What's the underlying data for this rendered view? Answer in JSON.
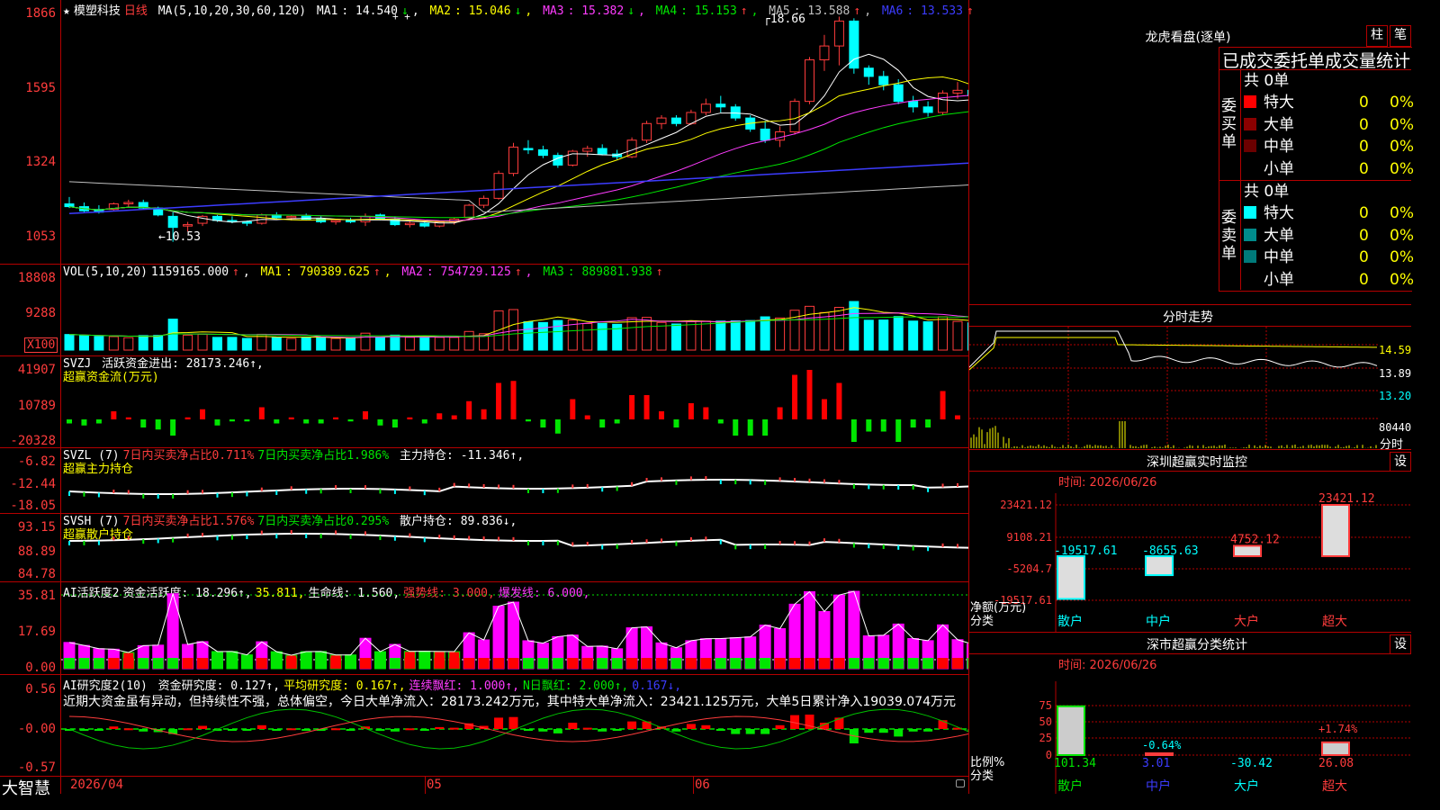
{
  "stock": {
    "star": "★",
    "name": "模塑科技",
    "period": "日线"
  },
  "ma_header": {
    "label": "MA(5,10,20,30,60,120)",
    "items": [
      {
        "name": "MA1",
        "value": "14.540",
        "arrow": "↓"
      },
      {
        "name": "MA2",
        "value": "15.046",
        "arrow": "↓"
      },
      {
        "name": "MA3",
        "value": "15.382",
        "arrow": "↓"
      },
      {
        "name": "MA4",
        "value": "15.153",
        "arrow": "↑"
      },
      {
        "name": "MA5",
        "value": "13.588",
        "arrow": "↑"
      },
      {
        "name": "MA6",
        "value": "13.533",
        "arrow": "↑"
      }
    ],
    "marks": "+ +"
  },
  "price_axis": [
    "1866",
    "1595",
    "1324",
    "1053"
  ],
  "price_annotations": {
    "high": "18.66",
    "low": "←10.53"
  },
  "vol_header": {
    "label": "VOL(5,10,20)",
    "value": "1159165.000",
    "arrow": "↑",
    "items": [
      {
        "name": "MA1",
        "value": "790389.625",
        "arrow": "↑"
      },
      {
        "name": "MA2",
        "value": "754729.125",
        "arrow": "↑"
      },
      {
        "name": "MA3",
        "value": "889881.938",
        "arrow": "↑"
      }
    ]
  },
  "vol_axis": [
    "18808",
    "9288",
    "X100"
  ],
  "svzj": {
    "label": "SVZJ",
    "title": "活跃资金进出: 28173.246↑,",
    "sub": "超赢资金流(万元)",
    "axis": [
      "41907",
      "10789",
      "-20328"
    ]
  },
  "svzl": {
    "label": "SVZL (7)",
    "p1": "7日内买卖净占比0.711%",
    "p2": "7日内买卖净占比1.986%",
    "p3": "主力持仓: -11.346↑,",
    "sub": "超赢主力持仓",
    "axis": [
      "-6.82",
      "-12.44",
      "-18.05"
    ]
  },
  "svsh": {
    "label": "SVSH (7)",
    "p1": "7日内买卖净占比1.576%",
    "p2": "7日内买卖净占比0.295%",
    "p3": "散户持仓: 89.836↓,",
    "sub": "超赢散户持仓",
    "axis": [
      "93.15",
      "88.89",
      "84.78"
    ]
  },
  "ai1": {
    "label": "AI活跃度2",
    "p1": "资金活跃度: 18.296↑,",
    "p2": "35.811,",
    "p3": "生命线: 1.560,",
    "p4": "强势线: 3.000,",
    "p5": "爆发线: 6.000,",
    "axis": [
      "35.81",
      "17.69",
      "0.00"
    ]
  },
  "ai2": {
    "label": "AI研究度2(10)",
    "p1": "资金研究度: 0.127↑,",
    "p2": "平均研究度: 0.167↑,",
    "p3": "连续飘红: 1.000↑,",
    "p4": "N日飘红: 2.000↑,",
    "p5": "0.167↓,",
    "text": "近期大资金虽有异动，但持续性不强，总体偏空，今日大单净流入：28173.242万元，其中特大单净流入：23421.125万元，大单5日累计净入19039.074万元",
    "axis": [
      "0.56",
      "-0.00",
      "-0.57"
    ]
  },
  "date_axis": {
    "left": "2026/04",
    "m05": "05",
    "m06": "06"
  },
  "brand": "大智慧",
  "lhb": {
    "title": "龙虎看盘(逐单)",
    "btn1": "柱",
    "btn2": "笔",
    "subtitle": "已成交委托单成交量统计",
    "buy": {
      "side": "委买单",
      "total": "共 0单",
      "rows": [
        {
          "label": "特大",
          "v": "0",
          "p": "0%",
          "color": "#ff0000"
        },
        {
          "label": "大单",
          "v": "0",
          "p": "0%",
          "color": "#8b0000"
        },
        {
          "label": "中单",
          "v": "0",
          "p": "0%",
          "color": "#6b0000"
        },
        {
          "label": "小单",
          "v": "0",
          "p": "0%",
          "color": ""
        }
      ]
    },
    "sell": {
      "side": "委卖单",
      "total": "共 0单",
      "rows": [
        {
          "label": "特大",
          "v": "0",
          "p": "0%",
          "color": "#00ffff"
        },
        {
          "label": "大单",
          "v": "0",
          "p": "0%",
          "color": "#008b8b"
        },
        {
          "label": "中单",
          "v": "0",
          "p": "0%",
          "color": "#007a7a"
        },
        {
          "label": "小单",
          "v": "0",
          "p": "0%",
          "color": ""
        }
      ]
    }
  },
  "intraday": {
    "title": "分时走势",
    "axis": [
      "14.59",
      "13.89",
      "13.20",
      "80440",
      "分时"
    ]
  },
  "sz_monitor": {
    "title": "深圳超赢实时监控",
    "btn": "设",
    "date": "时间: 2026/06/26",
    "axis": [
      "23421.12",
      "9108.21",
      "-5204.7",
      "-19517.61"
    ],
    "ylabel": "净额(万元)",
    "xlabel": "分类",
    "chart_data": {
      "type": "bar",
      "categories": [
        "散户",
        "中户",
        "大户",
        "超大"
      ],
      "values": [
        -19517.61,
        -8655.63,
        4752.12,
        23421.12
      ],
      "ylim": [
        -19517.61,
        23421.12
      ]
    },
    "value_labels": [
      "-19517.61",
      "-8655.63",
      "4752.12",
      "23421.12"
    ]
  },
  "sz_stats": {
    "title": "深市超赢分类统计",
    "btn": "设",
    "date": "时间: 2026/06/26",
    "axis": [
      "75",
      "50",
      "25",
      "0"
    ],
    "ylabel": "比例%",
    "xlabel": "分类",
    "chart_data": {
      "type": "bar",
      "categories": [
        "散户",
        "中户",
        "大户",
        "超大"
      ],
      "values": [
        101.34,
        3.01,
        -30.42,
        26.08
      ],
      "changes": [
        "",
        "-0.64%",
        "",
        "+1.74%"
      ]
    },
    "value_labels": [
      "101.34",
      "3.01",
      "-30.42",
      "26.08"
    ]
  },
  "colors": {
    "up": "#ff3c3c",
    "down": "#00ffff",
    "grid": "#b40000",
    "ma1": "#ffffff",
    "ma2": "#ffff00",
    "ma3": "#ff3cff",
    "ma4": "#00e600",
    "ma5": "#c0c0c0",
    "ma6": "#3c3cff"
  },
  "chart_data": {
    "type": "candlestick",
    "ylim": [
      10.53,
      18.66
    ],
    "candles": [
      [
        11.9,
        12.15,
        11.75,
        11.8
      ],
      [
        11.8,
        11.95,
        11.6,
        11.65
      ],
      [
        11.7,
        11.85,
        11.55,
        11.6
      ],
      [
        11.7,
        11.95,
        11.65,
        11.9
      ],
      [
        11.9,
        12.05,
        11.8,
        11.95
      ],
      [
        11.95,
        12.05,
        11.7,
        11.75
      ],
      [
        11.75,
        11.8,
        11.45,
        11.5
      ],
      [
        11.45,
        11.6,
        10.53,
        11.05
      ],
      [
        11.1,
        11.25,
        10.9,
        11.15
      ],
      [
        11.2,
        11.5,
        11.1,
        11.45
      ],
      [
        11.45,
        11.5,
        11.25,
        11.3
      ],
      [
        11.3,
        11.45,
        11.2,
        11.25
      ],
      [
        11.25,
        11.3,
        11.1,
        11.2
      ],
      [
        11.2,
        11.55,
        11.15,
        11.5
      ],
      [
        11.5,
        11.6,
        11.35,
        11.4
      ],
      [
        11.4,
        11.5,
        11.3,
        11.45
      ],
      [
        11.45,
        11.55,
        11.3,
        11.35
      ],
      [
        11.35,
        11.45,
        11.2,
        11.25
      ],
      [
        11.25,
        11.35,
        11.15,
        11.3
      ],
      [
        11.3,
        11.4,
        11.2,
        11.25
      ],
      [
        11.25,
        11.55,
        11.1,
        11.45
      ],
      [
        11.5,
        11.55,
        11.3,
        11.35
      ],
      [
        11.35,
        11.45,
        11.1,
        11.15
      ],
      [
        11.15,
        11.3,
        11.05,
        11.2
      ],
      [
        11.2,
        11.3,
        11.05,
        11.1
      ],
      [
        11.1,
        11.3,
        11.05,
        11.25
      ],
      [
        11.25,
        11.4,
        11.15,
        11.35
      ],
      [
        11.4,
        11.9,
        11.35,
        11.85
      ],
      [
        11.85,
        12.2,
        11.75,
        12.1
      ],
      [
        12.1,
        13.1,
        12.05,
        13.0
      ],
      [
        13.0,
        14.1,
        12.9,
        13.95
      ],
      [
        13.9,
        14.2,
        13.7,
        13.85
      ],
      [
        13.85,
        14.0,
        13.55,
        13.65
      ],
      [
        13.65,
        13.75,
        13.2,
        13.3
      ],
      [
        13.3,
        13.85,
        13.25,
        13.8
      ],
      [
        13.8,
        14.0,
        13.6,
        13.9
      ],
      [
        13.9,
        14.05,
        13.65,
        13.7
      ],
      [
        13.7,
        13.85,
        13.5,
        13.6
      ],
      [
        13.6,
        14.3,
        13.55,
        14.2
      ],
      [
        14.2,
        14.9,
        14.1,
        14.8
      ],
      [
        14.8,
        15.1,
        14.6,
        15.0
      ],
      [
        15.0,
        15.1,
        14.7,
        14.8
      ],
      [
        14.8,
        15.3,
        14.75,
        15.2
      ],
      [
        15.2,
        15.7,
        15.1,
        15.5
      ],
      [
        15.5,
        15.8,
        15.2,
        15.4
      ],
      [
        15.4,
        15.5,
        14.9,
        15.0
      ],
      [
        15.0,
        15.1,
        14.5,
        14.6
      ],
      [
        14.6,
        14.9,
        14.1,
        14.2
      ],
      [
        14.2,
        14.7,
        13.95,
        14.5
      ],
      [
        14.5,
        15.7,
        14.4,
        15.6
      ],
      [
        15.6,
        17.2,
        15.5,
        17.1
      ],
      [
        17.1,
        18.0,
        16.7,
        17.6
      ],
      [
        17.6,
        18.66,
        16.9,
        18.5
      ],
      [
        18.5,
        18.6,
        16.6,
        16.8
      ],
      [
        16.8,
        16.9,
        16.2,
        16.5
      ],
      [
        16.5,
        16.7,
        16.0,
        16.2
      ],
      [
        16.2,
        16.4,
        15.5,
        15.6
      ],
      [
        15.6,
        15.8,
        15.2,
        15.4
      ],
      [
        15.4,
        15.6,
        15.05,
        15.2
      ],
      [
        15.2,
        16.0,
        15.1,
        15.9
      ],
      [
        15.9,
        16.3,
        15.7,
        16.0
      ],
      [
        16.0,
        16.2,
        15.7,
        15.8
      ],
      [
        15.8,
        16.0,
        15.5,
        15.6
      ],
      [
        15.6,
        15.8,
        15.3,
        15.5
      ],
      [
        15.5,
        15.7,
        15.2,
        15.3
      ],
      [
        15.3,
        15.5,
        15.0,
        15.1
      ],
      [
        15.1,
        15.2,
        14.8,
        14.9
      ],
      [
        14.9,
        15.0,
        14.55,
        14.6
      ],
      [
        14.6,
        14.75,
        14.3,
        14.4
      ]
    ]
  }
}
